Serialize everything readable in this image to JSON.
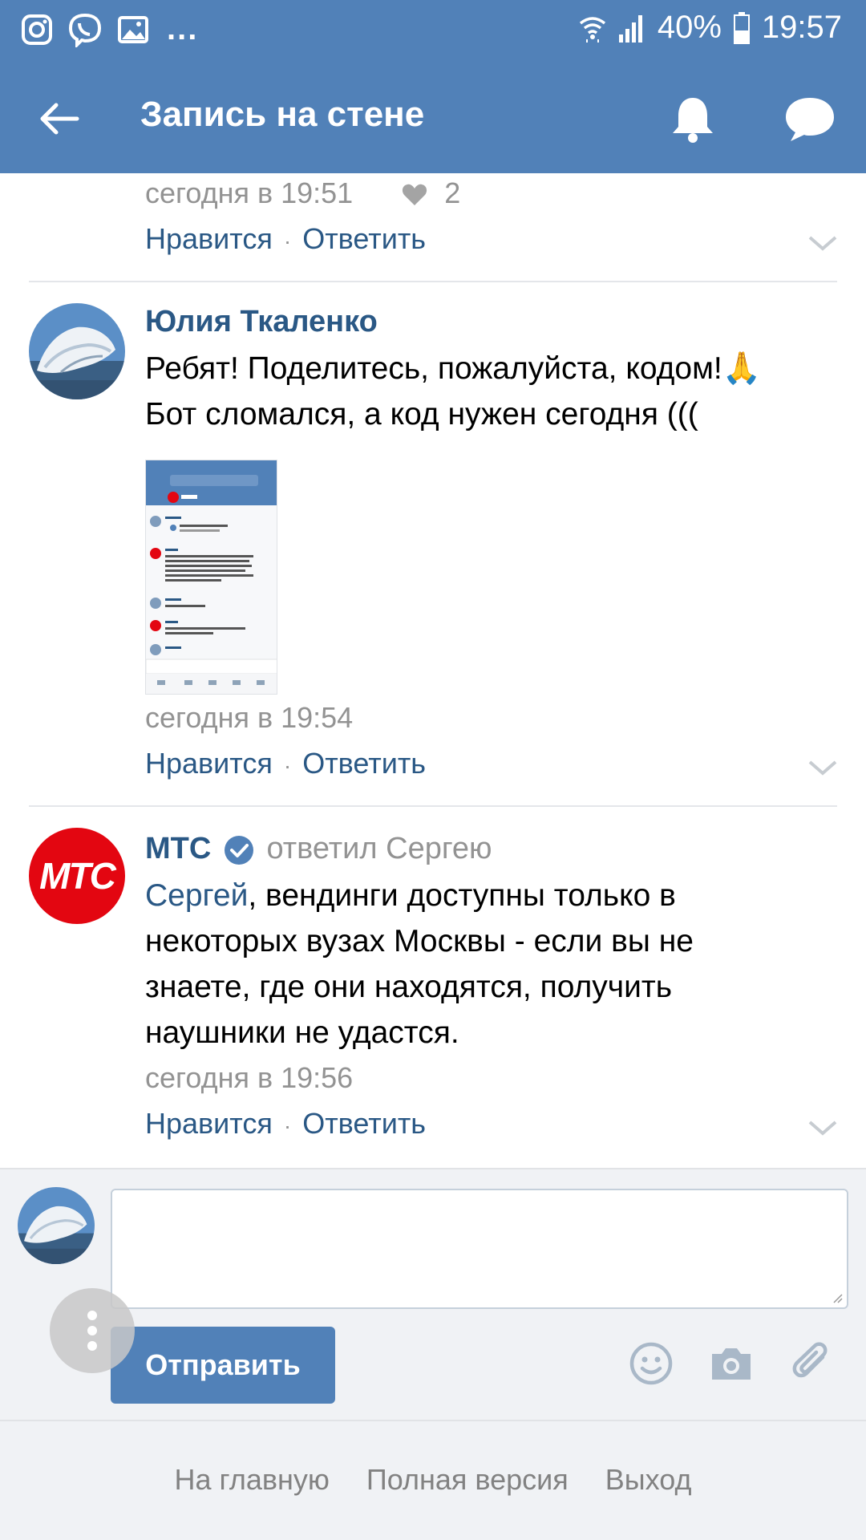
{
  "status_bar": {
    "battery": "40%",
    "time": "19:57",
    "more": "..."
  },
  "header": {
    "title": "Запись на стене"
  },
  "comments": [
    {
      "timestamp": "сегодня в 19:51",
      "likes": "2",
      "like_label": "Нравится",
      "reply_label": "Ответить"
    },
    {
      "author": "Юлия Ткаленко",
      "text_line1": "Ребят! Поделитесь, пожалуйста, кодом!🙏",
      "text_line2": "Бот сломался, а код нужен сегодня (((",
      "timestamp": "сегодня в 19:54",
      "like_label": "Нравится",
      "reply_label": "Ответить"
    },
    {
      "author": "МТС",
      "replied": "ответил Сергею",
      "mention": "Сергей",
      "text_line1_rest": ", вендинги доступны только в",
      "text_line2": "некоторых вузах Москвы - если вы не",
      "text_line3": "знаете, где они находятся, получить",
      "text_line4": "наушники не удастся.",
      "timestamp": "сегодня в 19:56",
      "like_label": "Нравится",
      "reply_label": "Ответить",
      "logo_text": "МТС"
    }
  ],
  "compose": {
    "send_label": "Отправить"
  },
  "footer": {
    "links": [
      "На главную",
      "Полная версия",
      "Выход"
    ]
  },
  "colors": {
    "brand": "#5181b8",
    "link": "#2a5885",
    "meta": "#939393",
    "mts_red": "#e30611"
  }
}
